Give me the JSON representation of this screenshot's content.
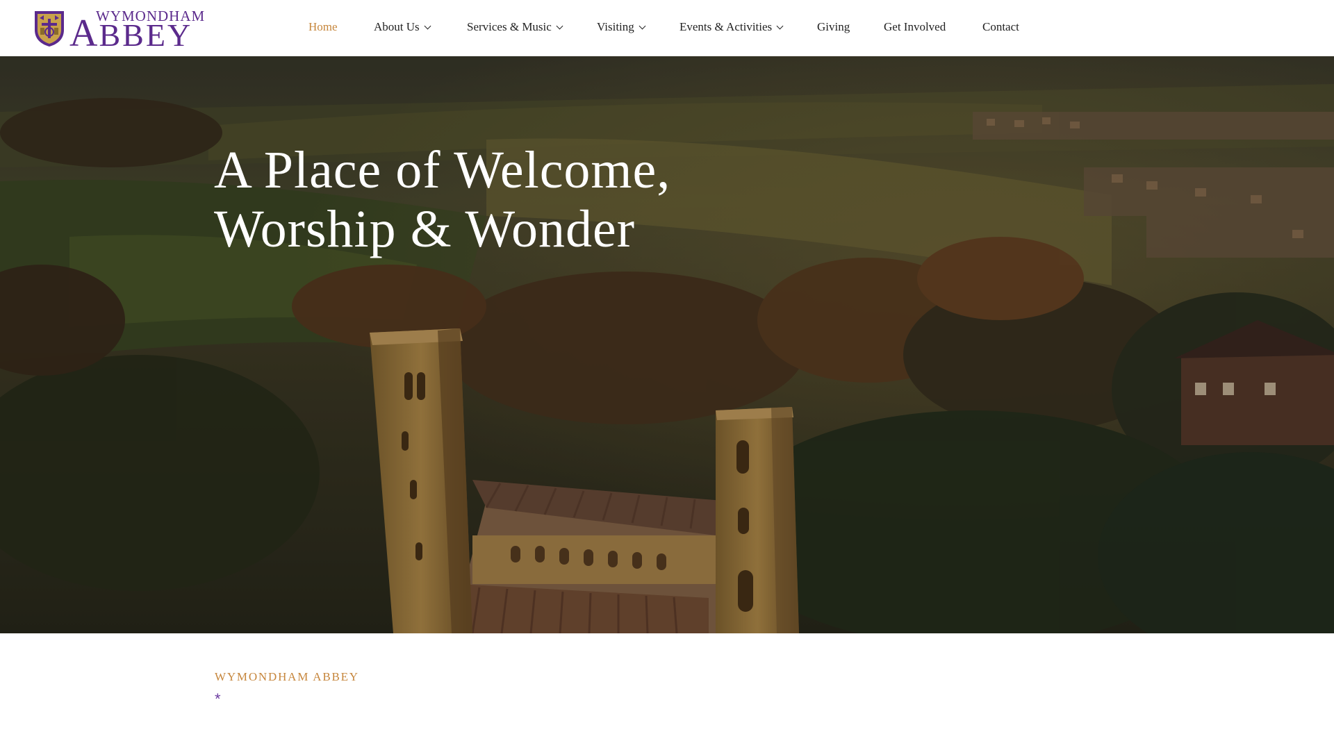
{
  "brand": {
    "name_small": "WYMONDHAM",
    "name_big_initial": "A",
    "name_big_rest": "BBEY",
    "color": "#5b2a8c"
  },
  "nav": {
    "items": [
      {
        "label": "Home",
        "active": true,
        "dropdown": false
      },
      {
        "label": "About Us",
        "active": false,
        "dropdown": true
      },
      {
        "label": "Services & Music",
        "active": false,
        "dropdown": true
      },
      {
        "label": "Visiting",
        "active": false,
        "dropdown": true
      },
      {
        "label": "Events & Activities",
        "active": false,
        "dropdown": true
      },
      {
        "label": "Giving",
        "active": false,
        "dropdown": false
      },
      {
        "label": "Get Involved",
        "active": false,
        "dropdown": false
      },
      {
        "label": "Contact",
        "active": false,
        "dropdown": false
      }
    ],
    "active_color": "#c6863c",
    "text_color": "#222222"
  },
  "hero": {
    "title_line1": "A Place of Welcome,",
    "title_line2": "Worship & Wonder",
    "image_subject": "aerial-abbey-towers-at-sunset"
  },
  "intro": {
    "kicker": "WYMONDHAM ABBEY",
    "decoration": "*",
    "kicker_color": "#c6863c",
    "decoration_color": "#6b3ba0"
  }
}
